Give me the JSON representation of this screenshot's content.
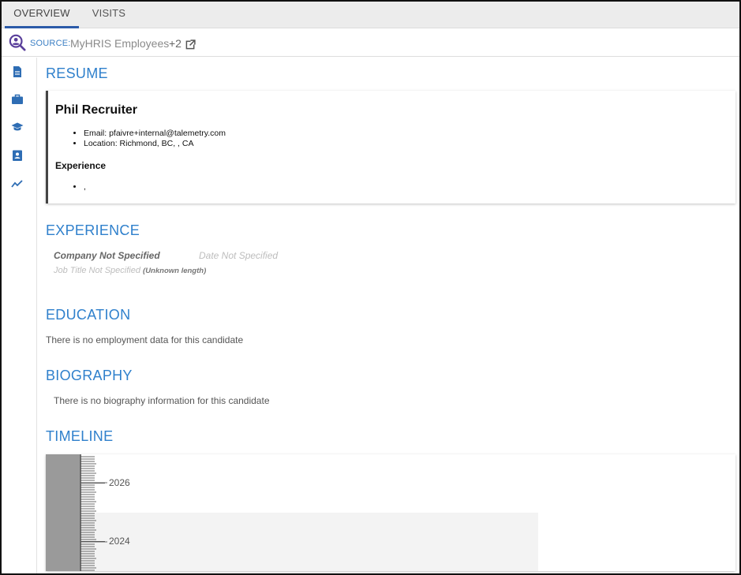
{
  "tabs": [
    {
      "label": "OVERVIEW",
      "active": true
    },
    {
      "label": "VISITS",
      "active": false
    }
  ],
  "source": {
    "label": "SOURCE:",
    "value": "MyHRIS Employees",
    "extra": "+2",
    "icon": "person-search-icon",
    "external_icon": "external-link-icon"
  },
  "sidebar": {
    "items": [
      {
        "icon": "document-icon"
      },
      {
        "icon": "briefcase-icon"
      },
      {
        "icon": "graduation-cap-icon"
      },
      {
        "icon": "contact-card-icon"
      },
      {
        "icon": "trend-line-icon"
      }
    ]
  },
  "resume": {
    "title": "RESUME",
    "name": "Phil Recruiter",
    "details": [
      "Email: pfaivre+internal@talemetry.com",
      "Location: Richmond, BC, , CA"
    ],
    "experience_heading": "Experience",
    "experience_items": [
      ","
    ]
  },
  "experience": {
    "title": "EXPERIENCE",
    "company": "Company Not Specified",
    "date": "Date Not Specified",
    "job_title": "Job Title Not Specified",
    "length": "(Unknown length)"
  },
  "education": {
    "title": "EDUCATION",
    "message": "There is no employment data for this candidate"
  },
  "biography": {
    "title": "BIOGRAPHY",
    "message": "There is no biography information for this candidate"
  },
  "timeline": {
    "title": "TIMELINE",
    "years": [
      "2026",
      "2024"
    ]
  },
  "colors": {
    "accent": "#2f80cc",
    "icon": "#2e6db4",
    "source_icon": "#5a3f9b"
  }
}
